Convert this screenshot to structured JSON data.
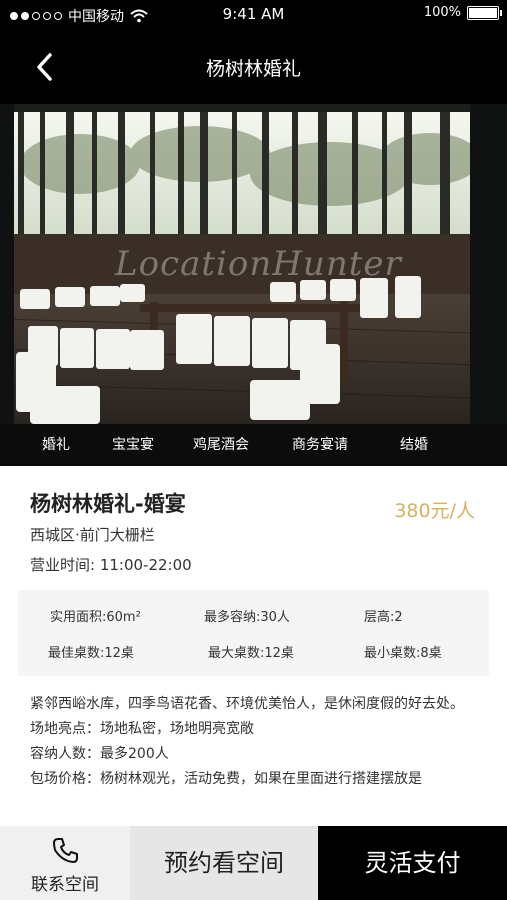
{
  "status_bar": {
    "carrier": "中国移动",
    "time": "9:41 AM",
    "battery": "100%",
    "battery_level": 1.0
  },
  "nav": {
    "title": "杨树林婚礼",
    "back_icon": "chevron-left-icon"
  },
  "hero": {
    "watermark": "LocationHunter"
  },
  "tabs": [
    "婚礼",
    "宝宝宴",
    "鸡尾酒会",
    "商务宴请",
    "结婚"
  ],
  "venue": {
    "title": "杨树林婚礼-婚宴",
    "price": "380元",
    "price_unit": "/人",
    "location": "西城区·前门大栅栏",
    "hours": "营业时间: 11:00-22:00",
    "price_color": "#d6b25e"
  },
  "specs": {
    "area": "实用面积:60m²",
    "max_capacity": "最多容纳:30人",
    "floor_height": "层高:2",
    "best_tables": "最佳桌数:12桌",
    "max_tables": "最大桌数:12桌",
    "min_tables": "最小桌数:8桌"
  },
  "description": {
    "intro": "紧邻西峪水库，四季鸟语花香、环境优美怡人，是休闲度假的好去处。",
    "highlights": "场地亮点：场地私密，场地明亮宽敞",
    "capacity": "容纳人数：最多200人",
    "package": "包场价格：杨树林观光，活动免费，如果在里面进行搭建摆放是"
  },
  "bottom": {
    "contact_label": "联系空间",
    "contact_icon": "phone-icon",
    "reserve_label": "预约看空间",
    "pay_label": "灵活支付"
  }
}
